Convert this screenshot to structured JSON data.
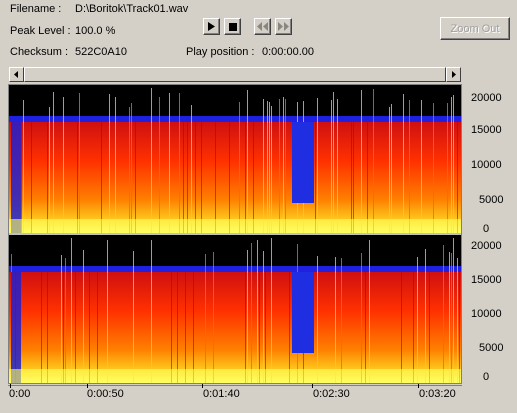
{
  "info": {
    "filename_label": "Filename :",
    "filename_value": "D:\\Boritok\\Track01.wav",
    "peak_label": "Peak Level :",
    "peak_value": "100.0 %",
    "checksum_label": "Checksum :",
    "checksum_value": "522C0A10",
    "position_label": "Play position :",
    "position_value": "0:00:00.00"
  },
  "toolbar": {
    "play_icon": "play-icon",
    "stop_icon": "stop-icon",
    "rewind_icon": "rewind-icon",
    "forward_icon": "fast-forward-icon",
    "zoom_out_label": "Zoom Out"
  },
  "channels": [
    {
      "name": "top",
      "y_ticks": [
        "20000",
        "15000",
        "10000",
        "5000",
        "0"
      ]
    },
    {
      "name": "bottom",
      "y_ticks": [
        "20000",
        "15000",
        "10000",
        "5000",
        "0"
      ]
    }
  ],
  "time_axis": {
    "ticks": [
      "0:00",
      "0:00:50",
      "0:01:40",
      "0:02:30",
      "0:03:20"
    ]
  },
  "colors": {
    "background": "#d4d0c8",
    "spectrum_high": "#ffff40",
    "spectrum_mid": "#ff4000",
    "spectrum_low": "#2020ff",
    "spectrum_none": "#000000"
  }
}
